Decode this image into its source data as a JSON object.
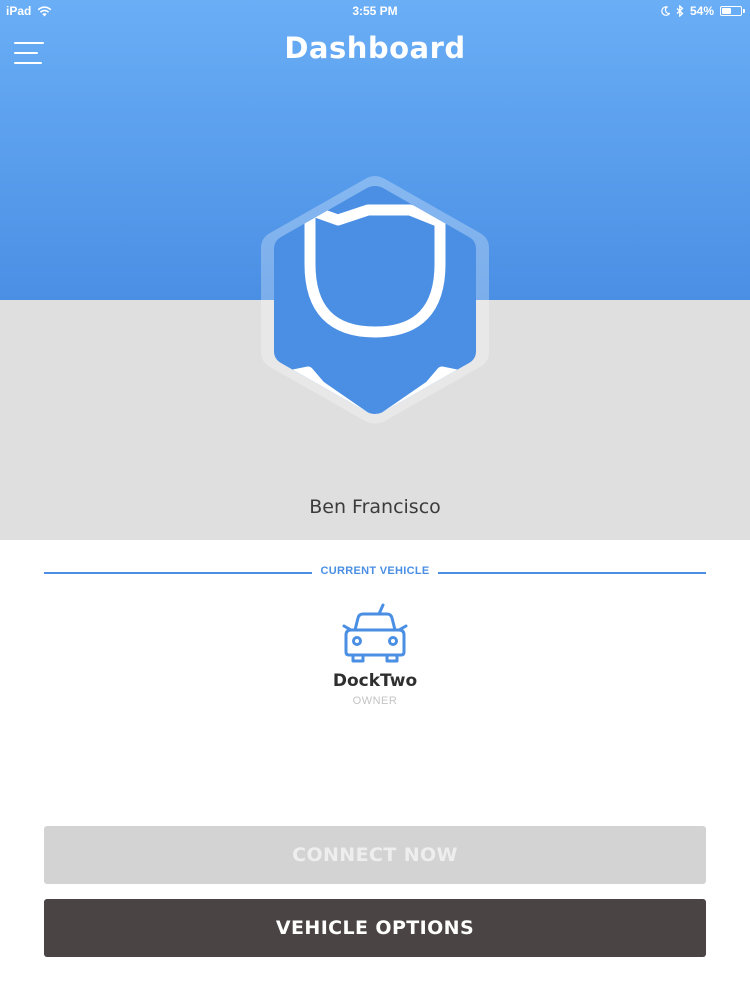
{
  "status_bar": {
    "device": "iPad",
    "time": "3:55 PM",
    "battery": "54%",
    "battery_level": 0.54,
    "icons": [
      "wifi-icon",
      "moon-icon",
      "bluetooth-icon",
      "battery-icon"
    ]
  },
  "header": {
    "title": "Dashboard",
    "menu_icon": "hamburger-menu-icon"
  },
  "profile": {
    "avatar_icon": "shield-hexagon-logo-icon",
    "name": "Ben Francisco"
  },
  "current_vehicle": {
    "section_label": "CURRENT VEHICLE",
    "icon": "car-icon",
    "name": "DockTwo",
    "role": "OWNER"
  },
  "actions": {
    "connect_label": "CONNECT NOW",
    "options_label": "VEHICLE OPTIONS"
  },
  "colors": {
    "header_top": "#6aaef6",
    "header_bottom": "#4a8fe4",
    "accent": "#4a8fe4",
    "profile_band": "#dfdfdf",
    "connect_disabled": "#d3d3d3",
    "options_button": "#4a4444"
  }
}
